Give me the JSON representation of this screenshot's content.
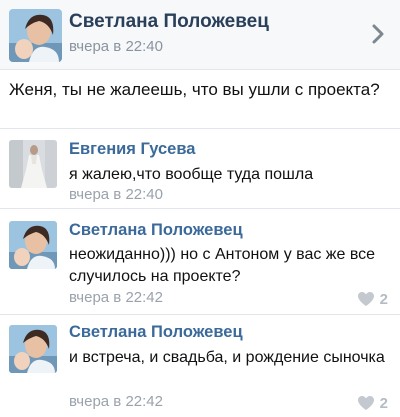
{
  "post": {
    "author": "Светлана Положевец",
    "time": "вчера в 22:40",
    "text": "Женя, ты не жалеешь, что вы ушли с проекта?"
  },
  "comments": [
    {
      "author": "Евгения Гусева",
      "text": "я жалею,что вообще туда пошла",
      "time": "вчера в 22:40",
      "likes": ""
    },
    {
      "author": "Светлана Положевец",
      "text": "неожиданно))) но с Антоном у вас же все случилось на проекте?",
      "time": "вчера в 22:42",
      "likes": "2"
    },
    {
      "author": "Светлана Положевец",
      "text": "и встреча, и свадьба, и рождение сыночка",
      "time": "вчера в 22:42",
      "likes": "2"
    }
  ],
  "icons": {
    "chevron": "chevron-right-icon",
    "like": "heart-icon"
  },
  "colors": {
    "author_link": "#3b6a9a",
    "header_author": "#2a3f5a",
    "timestamp": "#9aa2ab",
    "like_gray": "#b5bcc4"
  }
}
